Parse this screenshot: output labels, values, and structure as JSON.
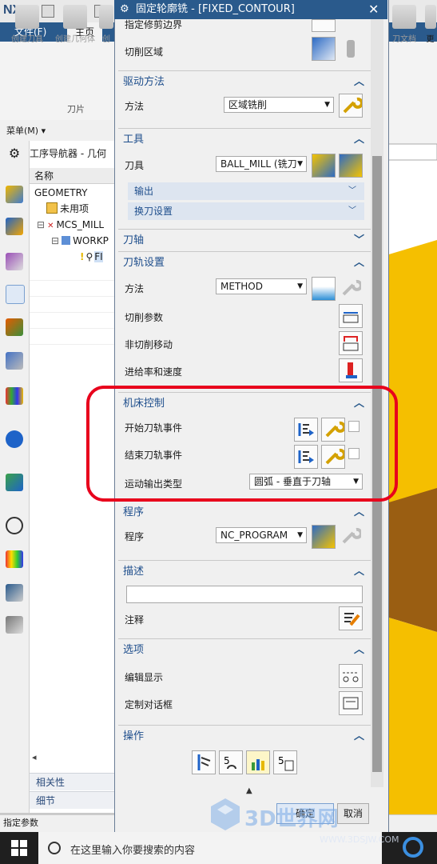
{
  "nx": {
    "logo": "NX",
    "tabs": [
      "文件(F)",
      "主页"
    ],
    "ribbon_buttons": [
      "创建刀具",
      "创建几何体",
      "创"
    ],
    "ribbon_right_button": "刀文档",
    "ribbon_right_partial": "更",
    "group_label": "刀片",
    "menu_label": "菜单(M) ▾"
  },
  "navigator": {
    "title": "工序导航器 - 几何",
    "column_header": "名称",
    "rows": [
      "GEOMETRY",
      "未用项",
      "MCS_MILL",
      "WORKP",
      "FI"
    ],
    "bottom_tabs": [
      "相关性",
      "细节"
    ]
  },
  "status_text": "指定参数",
  "taskbar": {
    "search_placeholder": "在这里输入你要搜索的内容"
  },
  "dialog": {
    "title": "固定轮廓铣 - [FIXED_CONTOUR]",
    "partial_top_label": "指定修剪边界",
    "cut_area_label": "切削区域",
    "sections": {
      "drive": {
        "title": "驱动方法",
        "method_label": "方法",
        "method_value": "区域铣削"
      },
      "tool": {
        "title": "工具",
        "tool_label": "刀具",
        "tool_value": "BALL_MILL (铣刀",
        "sub_output": "输出",
        "sub_change": "换刀设置"
      },
      "axis": {
        "title": "刀轴"
      },
      "path": {
        "title": "刀轨设置",
        "method_label": "方法",
        "method_value": "METHOD",
        "cut_params": "切削参数",
        "non_cut": "非切削移动",
        "feeds": "进给率和速度"
      },
      "machine": {
        "title": "机床控制",
        "start_event": "开始刀轨事件",
        "end_event": "结束刀轨事件",
        "motion_label": "运动输出类型",
        "motion_value": "圆弧 - 垂直于刀轴"
      },
      "program": {
        "title": "程序",
        "program_label": "程序",
        "program_value": "NC_PROGRAM"
      },
      "desc": {
        "title": "描述",
        "note_label": "注释"
      },
      "options": {
        "title": "选项",
        "edit_display": "编辑显示",
        "custom_dialog": "定制对话框"
      },
      "ops": {
        "title": "操作"
      }
    },
    "ok_label": "确定",
    "cancel_label": "取消"
  },
  "watermark": {
    "text": "3D世界网",
    "url": "WWW.3DSJW.COM"
  },
  "colors": {
    "title_blue": "#2a5a8c",
    "section_text": "#1e4e8c",
    "annotation_red": "#e8001c",
    "model_yellow": "#f5bf00",
    "model_brown": "#9a5e12"
  }
}
